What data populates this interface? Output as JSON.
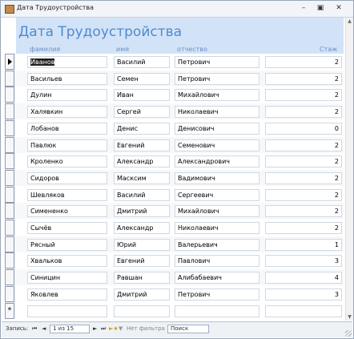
{
  "window": {
    "title": "Дата Трудоустройства",
    "minimize_icon": "minimize-icon",
    "restore_icon": "restore-icon",
    "close_icon": "close-icon"
  },
  "form": {
    "title": "Дата Трудоустройства",
    "columns": {
      "surname": "фамилия",
      "name": "имя",
      "patronymic": "отчество",
      "experience": "Стаж"
    }
  },
  "records": [
    {
      "surname": "Иванов",
      "name": "Василий",
      "patronymic": "Петрович",
      "experience": "2"
    },
    {
      "surname": "Васильев",
      "name": "Семен",
      "patronymic": "Петрович",
      "experience": "2"
    },
    {
      "surname": "Дулин",
      "name": "Иван",
      "patronymic": "Михайлович",
      "experience": "2"
    },
    {
      "surname": "Халявкин",
      "name": "Сергей",
      "patronymic": "Николаевич",
      "experience": "2"
    },
    {
      "surname": "Лобанов",
      "name": "Денис",
      "patronymic": "Денисович",
      "experience": "0"
    },
    {
      "surname": "Павлюк",
      "name": "Евгений",
      "patronymic": "Семенович",
      "experience": "2"
    },
    {
      "surname": "Кроленко",
      "name": "Александр",
      "patronymic": "Александрович",
      "experience": "2"
    },
    {
      "surname": "Сидоров",
      "name": "Масксим",
      "patronymic": "Вадимович",
      "experience": "2"
    },
    {
      "surname": "Шевляков",
      "name": "Василий",
      "patronymic": "Сергеевич",
      "experience": "2"
    },
    {
      "surname": "Симененко",
      "name": "Дмитрий",
      "patronymic": "Михайлович",
      "experience": "2"
    },
    {
      "surname": "Сычёв",
      "name": "Александр",
      "patronymic": "Николаевич",
      "experience": "2"
    },
    {
      "surname": "Рясный",
      "name": "Юрий",
      "patronymic": "Валерьевич",
      "experience": "1"
    },
    {
      "surname": "Хвальков",
      "name": "Евгений",
      "patronymic": "Павлович",
      "experience": "3"
    },
    {
      "surname": "Синицин",
      "name": "Равшан",
      "patronymic": "Алибабаевич",
      "experience": "4"
    },
    {
      "surname": "Яковлев",
      "name": "Дмитрий",
      "patronymic": "Петрович",
      "experience": "3"
    }
  ],
  "navigation": {
    "records_label": "Запись:",
    "first_icon": "first-record-icon",
    "prev_icon": "previous-record-icon",
    "position": "1 из 15",
    "next_icon": "next-record-icon",
    "last_icon": "last-record-icon",
    "new_icon": "new-record-icon",
    "filter_icon": "filter-icon",
    "filter_label": "Нет фильтра",
    "search_placeholder": "Поиск"
  }
}
